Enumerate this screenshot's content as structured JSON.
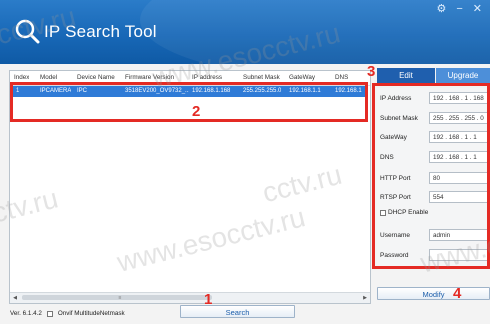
{
  "app": {
    "title": "IP Search Tool",
    "version": "Ver. 6.1.4.2"
  },
  "window_controls": {
    "settings": "⚙",
    "minimize": "−",
    "close": "✕"
  },
  "watermarks": [
    "cctv.ru",
    "www.esocctv.ru",
    "ctv.ru",
    "cctv.ru",
    "www.esocctv.ru",
    "www.e"
  ],
  "table": {
    "columns": [
      "Index",
      "Model",
      "Device Name",
      "Firmware Version",
      "IP address",
      "Subnet Mask",
      "GateWay",
      "DNS"
    ],
    "rows": [
      [
        "1",
        "IPCAMERA",
        "IPC",
        "3518EV200_OV9732_...",
        "192.168.1.168",
        "255.255.255.0",
        "192.168.1.1",
        "192.168.1"
      ]
    ]
  },
  "markers": [
    "1",
    "2",
    "3",
    "4"
  ],
  "tabs": {
    "edit": "Edit",
    "upgrade": "Upgrade"
  },
  "form": {
    "ip_address": {
      "label": "IP Address",
      "value": "192 . 168 . 1 . 168"
    },
    "subnet_mask": {
      "label": "Subnet Mask",
      "value": "255 . 255 . 255 . 0"
    },
    "gateway": {
      "label": "GateWay",
      "value": "192 . 168 . 1 . 1"
    },
    "dns": {
      "label": "DNS",
      "value": "192 . 168 . 1 . 1"
    },
    "http_port": {
      "label": "HTTP Port",
      "value": "80"
    },
    "rtsp_port": {
      "label": "RTSP Port",
      "value": "554"
    },
    "dhcp": {
      "label": "DHCP Enable"
    },
    "username": {
      "label": "Username",
      "value": "admin"
    },
    "password": {
      "label": "Password",
      "value": ""
    }
  },
  "buttons": {
    "search": "Search",
    "modify": "Modify"
  },
  "onvif_label": "Onvif MultitudeNetmask",
  "colors": {
    "titlebar": "#1868b7",
    "selection": "#2f7bd7",
    "highlight": "#e42a24"
  }
}
